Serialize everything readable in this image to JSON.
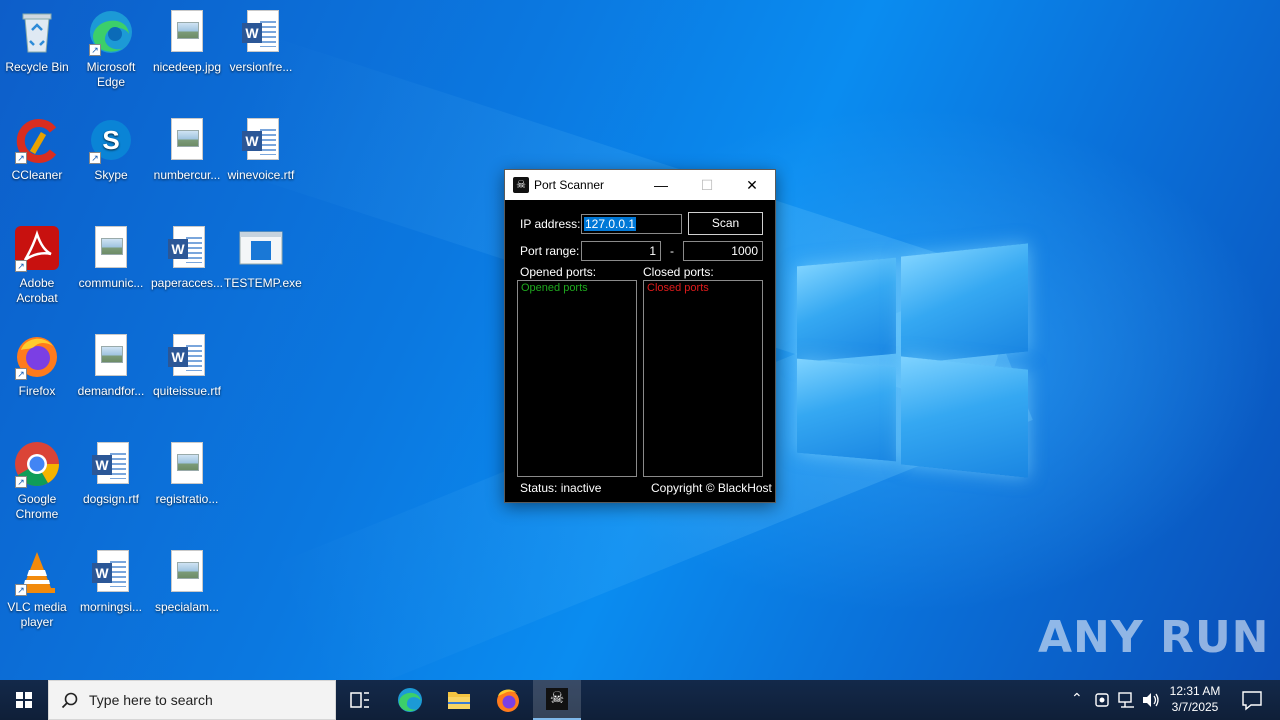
{
  "desktop": {
    "icons": [
      {
        "label": "Recycle Bin",
        "icon": "recycle-bin-icon"
      },
      {
        "label": "Microsoft Edge",
        "icon": "edge-icon"
      },
      {
        "label": "nicedeep.jpg",
        "icon": "image-file-icon"
      },
      {
        "label": "versionfre...",
        "icon": "word-file-icon"
      },
      {
        "label": "CCleaner",
        "icon": "ccleaner-icon"
      },
      {
        "label": "Skype",
        "icon": "skype-icon"
      },
      {
        "label": "numbercur...",
        "icon": "image-file-icon"
      },
      {
        "label": "winevoice.rtf",
        "icon": "word-file-icon"
      },
      {
        "label": "Adobe Acrobat",
        "icon": "acrobat-icon"
      },
      {
        "label": "communic...",
        "icon": "image-file-icon"
      },
      {
        "label": "paperacces...",
        "icon": "word-file-icon"
      },
      {
        "label": "TESTEMP.exe",
        "icon": "exe-file-icon"
      },
      {
        "label": "Firefox",
        "icon": "firefox-icon"
      },
      {
        "label": "demandfor...",
        "icon": "image-file-icon"
      },
      {
        "label": "quiteissue.rtf",
        "icon": "word-file-icon"
      },
      {
        "label": "Google Chrome",
        "icon": "chrome-icon"
      },
      {
        "label": "dogsign.rtf",
        "icon": "word-file-icon"
      },
      {
        "label": "registratio...",
        "icon": "image-file-icon"
      },
      {
        "label": "VLC media player",
        "icon": "vlc-icon"
      },
      {
        "label": "morningsi...",
        "icon": "word-file-icon"
      },
      {
        "label": "specialam...",
        "icon": "image-file-icon"
      }
    ]
  },
  "port_scanner": {
    "title": "Port Scanner",
    "ip_label": "IP address:",
    "ip_value": "127.0.0.1",
    "scan_label": "Scan",
    "port_range_label": "Port range:",
    "port_from": "1",
    "port_separator": "-",
    "port_to": "1000",
    "opened_label": "Opened ports:",
    "closed_label": "Closed ports:",
    "opened_placeholder": "Opened ports",
    "closed_placeholder": "Closed ports",
    "status": "Status: inactive",
    "copyright": "Copyright © BlackHost",
    "colors": {
      "opened": "#1ea81e",
      "closed": "#e01b1b"
    }
  },
  "taskbar": {
    "search_placeholder": "Type here to search",
    "time": "12:31 AM",
    "date": "3/7/2025"
  },
  "watermark": "ANY RUN"
}
